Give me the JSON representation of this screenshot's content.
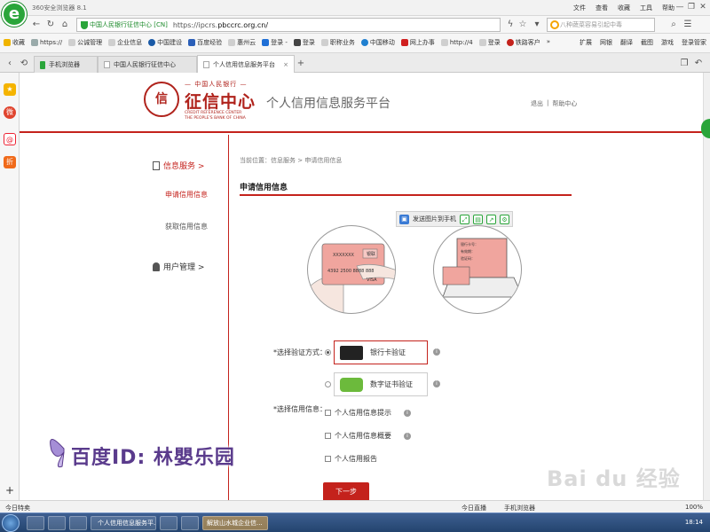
{
  "browser": {
    "app_name": "360安全浏览器 8.1",
    "top_menu": [
      "文件",
      "查看",
      "收藏",
      "工具",
      "帮助"
    ],
    "secure_badge": "中国人民银行征信中心 [CN]",
    "url_prefix": "https://ipcrs.",
    "url_domain": "pbccrc.org.cn/",
    "search_placeholder": "八种蔬菜容易引起中毒"
  },
  "favorites": {
    "items": [
      {
        "label": "收藏",
        "color": "#f0b400"
      },
      {
        "label": "https://",
        "color": "#9aa"
      },
      {
        "label": "公诚管理",
        "color": "#cfcfcf"
      },
      {
        "label": "企业信息",
        "color": "#cfcfcf"
      },
      {
        "label": "中国建设",
        "color": "#1a5aa6"
      },
      {
        "label": "百度经验",
        "color": "#2b5fb8"
      },
      {
        "label": "惠州云",
        "color": "#cfcfcf"
      },
      {
        "label": "登录 -",
        "color": "#1f6fd6"
      },
      {
        "label": "登录",
        "color": "#444"
      },
      {
        "label": "职称业务",
        "color": "#cfcfcf"
      },
      {
        "label": "中国移动",
        "color": "#2080d0"
      },
      {
        "label": "网上办事",
        "color": "#d02020"
      },
      {
        "label": "http://4",
        "color": "#cfcfcf"
      },
      {
        "label": "登录",
        "color": "#cfcfcf"
      },
      {
        "label": "铁路客户",
        "color": "#c4221c"
      }
    ],
    "more": "»",
    "right": [
      "扩展",
      "网银",
      "翻译",
      "截图",
      "游戏",
      "登录管家"
    ]
  },
  "tabs": [
    {
      "label": "手机浏览器",
      "active": false
    },
    {
      "label": "中国人民银行征信中心",
      "active": false
    },
    {
      "label": "个人信用信息服务平台",
      "active": true
    }
  ],
  "header": {
    "seal_char": "信",
    "org_top": "— 中国人民银行 —",
    "org_name": "征信中心",
    "org_en_1": "CREDIT REFERENCE CENTER",
    "org_en_2": "THE PEOPLE'S BANK OF CHINA",
    "platform_title": "个人信用信息服务平台",
    "logout": "退出",
    "separator": "|",
    "help": "帮助中心"
  },
  "nav": {
    "info_service": "信息服务 >",
    "apply": "申请信用信息",
    "fetch": "获取信用信息",
    "user_mgmt": "用户管理 >"
  },
  "content": {
    "breadcrumb": "当前位置：信息服务 > 申请信用信息",
    "section_title": "申请信用信息",
    "send_to_phone": "发送图片到手机",
    "card_number": "4392 2500 8888 888",
    "card_x": "XXXXXXX",
    "card_brand": "VISA",
    "card_chip": "银联",
    "laptop_form": [
      "银行卡号：",
      "有效期：",
      "验证码："
    ],
    "verify_label": "*选择验证方式：",
    "verify_options": [
      {
        "label": "银行卡验证",
        "selected": true
      },
      {
        "label": "数字证书验证",
        "selected": false
      }
    ],
    "select_label": "*选择信用信息：",
    "select_options": [
      "个人信用信息提示",
      "个人信用信息概要",
      "个人信用报告"
    ],
    "next_button": "下一步"
  },
  "overlay": {
    "watermark": "百度ID: 林嬰乐园",
    "baidu_logo": "Bai du 经验"
  },
  "statusbar": {
    "left": "今日特卖",
    "right": [
      "今日直播",
      "手机浏览器",
      "",
      "100%"
    ]
  },
  "taskbar": {
    "buttons": [
      "",
      "",
      "",
      "个人信用信息服务平...",
      "",
      "",
      "解放山水城企业信..."
    ],
    "clock": "18:14"
  }
}
